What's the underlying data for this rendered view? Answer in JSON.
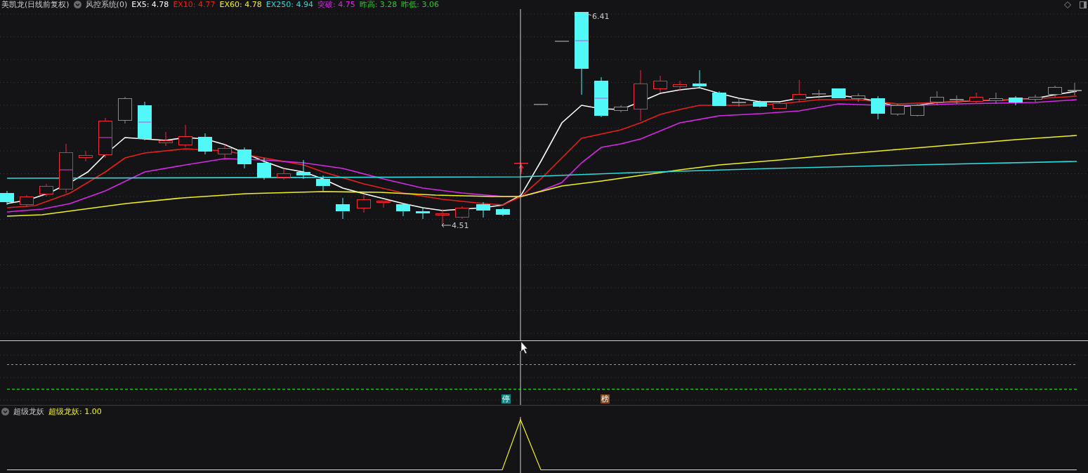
{
  "header": {
    "title": "美凯龙(日线前复权)",
    "formula": "风控系统(0)",
    "legend": [
      {
        "label": "EX5: 4.78",
        "color": "#ffffff"
      },
      {
        "label": "EX10: 4.77",
        "color": "#e8201c"
      },
      {
        "label": "EX60: 4.78",
        "color": "#f0f020"
      },
      {
        "label": "EX250: 4.94",
        "color": "#30d8d8"
      },
      {
        "label": "突破: 4.75",
        "color": "#d828e8"
      },
      {
        "label": "昨高: 3.28",
        "color": "#30c830"
      },
      {
        "label": "昨低: 3.06",
        "color": "#30c830"
      }
    ]
  },
  "price_chart": {
    "high_label": "6.41",
    "low_label": "4.51"
  },
  "signal_panel": {
    "markers": [
      {
        "text": "停",
        "color": "#138585"
      },
      {
        "text": "榜",
        "color": "#8a4512"
      }
    ]
  },
  "indicator": {
    "name": "超级龙妖",
    "legend": [
      {
        "label": "超级龙妖: 1.00",
        "color": "#f0f020"
      }
    ]
  }
}
